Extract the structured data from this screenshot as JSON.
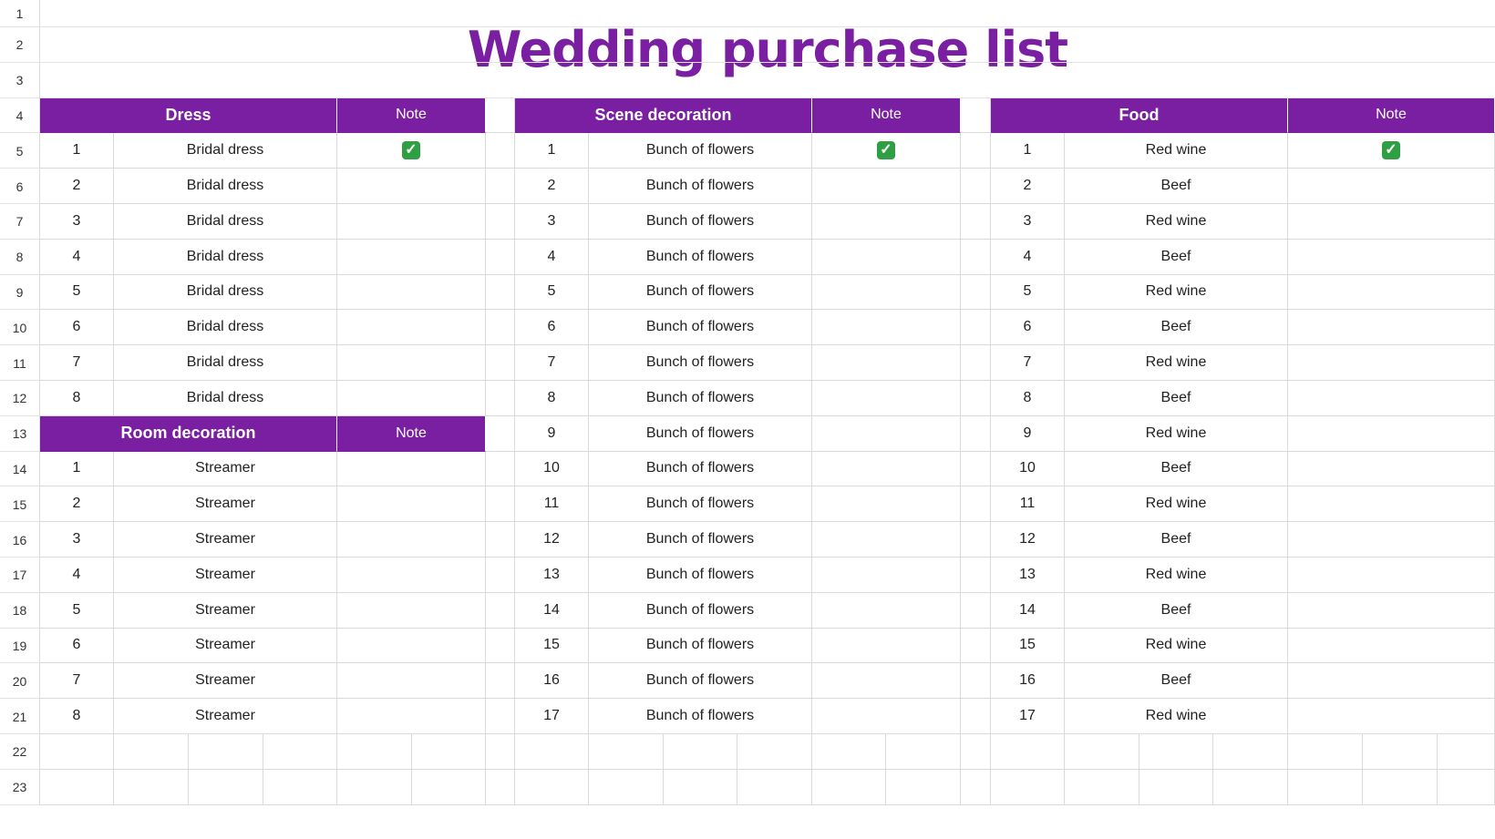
{
  "sheet": {
    "title": "Wedding purchase list",
    "row_numbers": [
      "1",
      "2",
      "3",
      "4",
      "5",
      "6",
      "7",
      "8",
      "9",
      "10",
      "11",
      "12",
      "13",
      "14",
      "15",
      "16",
      "17",
      "18",
      "19",
      "20",
      "21",
      "22",
      "23"
    ],
    "colors": {
      "header_bg": "#7a1fa2",
      "title": "#7a1fa2",
      "check": "#2ea043"
    }
  },
  "dress": {
    "header": "Dress",
    "note_label": "Note",
    "rows": [
      {
        "num": "1",
        "item": "Bridal dress",
        "done": true
      },
      {
        "num": "2",
        "item": "Bridal dress",
        "done": false
      },
      {
        "num": "3",
        "item": "Bridal dress",
        "done": false
      },
      {
        "num": "4",
        "item": "Bridal dress",
        "done": false
      },
      {
        "num": "5",
        "item": "Bridal dress",
        "done": false
      },
      {
        "num": "6",
        "item": "Bridal dress",
        "done": false
      },
      {
        "num": "7",
        "item": "Bridal dress",
        "done": false
      },
      {
        "num": "8",
        "item": "Bridal dress",
        "done": false
      }
    ]
  },
  "room": {
    "header": "Room decoration",
    "note_label": "Note",
    "rows": [
      {
        "num": "1",
        "item": "Streamer",
        "done": false
      },
      {
        "num": "2",
        "item": "Streamer",
        "done": false
      },
      {
        "num": "3",
        "item": "Streamer",
        "done": false
      },
      {
        "num": "4",
        "item": "Streamer",
        "done": false
      },
      {
        "num": "5",
        "item": "Streamer",
        "done": false
      },
      {
        "num": "6",
        "item": "Streamer",
        "done": false
      },
      {
        "num": "7",
        "item": "Streamer",
        "done": false
      },
      {
        "num": "8",
        "item": "Streamer",
        "done": false
      }
    ]
  },
  "scene": {
    "header": "Scene decoration",
    "note_label": "Note",
    "rows": [
      {
        "num": "1",
        "item": "Bunch of flowers",
        "done": true
      },
      {
        "num": "2",
        "item": "Bunch of flowers",
        "done": false
      },
      {
        "num": "3",
        "item": "Bunch of flowers",
        "done": false
      },
      {
        "num": "4",
        "item": "Bunch of flowers",
        "done": false
      },
      {
        "num": "5",
        "item": "Bunch of flowers",
        "done": false
      },
      {
        "num": "6",
        "item": "Bunch of flowers",
        "done": false
      },
      {
        "num": "7",
        "item": "Bunch of flowers",
        "done": false
      },
      {
        "num": "8",
        "item": "Bunch of flowers",
        "done": false
      },
      {
        "num": "9",
        "item": "Bunch of flowers",
        "done": false
      },
      {
        "num": "10",
        "item": "Bunch of flowers",
        "done": false
      },
      {
        "num": "11",
        "item": "Bunch of flowers",
        "done": false
      },
      {
        "num": "12",
        "item": "Bunch of flowers",
        "done": false
      },
      {
        "num": "13",
        "item": "Bunch of flowers",
        "done": false
      },
      {
        "num": "14",
        "item": "Bunch of flowers",
        "done": false
      },
      {
        "num": "15",
        "item": "Bunch of flowers",
        "done": false
      },
      {
        "num": "16",
        "item": "Bunch of flowers",
        "done": false
      },
      {
        "num": "17",
        "item": "Bunch of flowers",
        "done": false
      }
    ]
  },
  "food": {
    "header": "Food",
    "note_label": "Note",
    "rows": [
      {
        "num": "1",
        "item": "Red wine",
        "done": true
      },
      {
        "num": "2",
        "item": "Beef",
        "done": false
      },
      {
        "num": "3",
        "item": "Red wine",
        "done": false
      },
      {
        "num": "4",
        "item": "Beef",
        "done": false
      },
      {
        "num": "5",
        "item": "Red wine",
        "done": false
      },
      {
        "num": "6",
        "item": "Beef",
        "done": false
      },
      {
        "num": "7",
        "item": "Red wine",
        "done": false
      },
      {
        "num": "8",
        "item": "Beef",
        "done": false
      },
      {
        "num": "9",
        "item": "Red wine",
        "done": false
      },
      {
        "num": "10",
        "item": "Beef",
        "done": false
      },
      {
        "num": "11",
        "item": "Red wine",
        "done": false
      },
      {
        "num": "12",
        "item": "Beef",
        "done": false
      },
      {
        "num": "13",
        "item": "Red wine",
        "done": false
      },
      {
        "num": "14",
        "item": "Beef",
        "done": false
      },
      {
        "num": "15",
        "item": "Red wine",
        "done": false
      },
      {
        "num": "16",
        "item": "Beef",
        "done": false
      },
      {
        "num": "17",
        "item": "Red wine",
        "done": false
      }
    ]
  }
}
